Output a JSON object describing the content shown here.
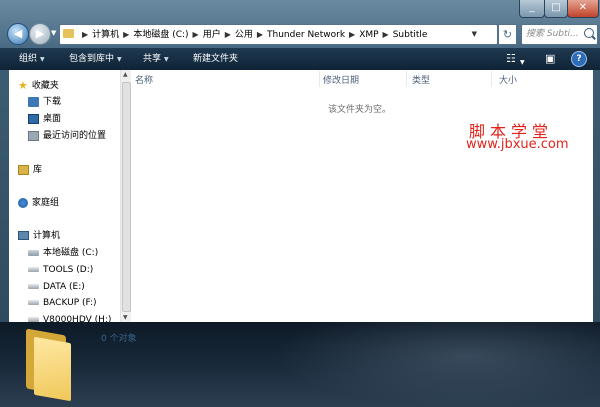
{
  "address": {
    "crumbs": [
      "计算机",
      "本地磁盘 (C:)",
      "用户",
      "公用",
      "Thunder Network",
      "XMP",
      "Subtitle"
    ],
    "search_placeholder": "搜索 Subti..."
  },
  "toolbar": {
    "organize": "组织",
    "include_library": "包含到库中",
    "share": "共享",
    "new_folder": "新建文件夹"
  },
  "nav": {
    "favorites": "收藏夹",
    "downloads": "下载",
    "desktop": "桌面",
    "recent": "最近访问的位置",
    "libraries": "库",
    "homegroup": "家庭组",
    "computer": "计算机",
    "drives": [
      "本地磁盘 (C:)",
      "TOOLS (D:)",
      "DATA (E:)",
      "BACKUP (F:)",
      "V8000HDV (H:)"
    ]
  },
  "columns": [
    "名称",
    "修改日期",
    "类型",
    "大小"
  ],
  "empty_message": "该文件夹为空。",
  "watermark": {
    "line1": "脚本学堂",
    "line2": "www.jbxue.com"
  },
  "details": {
    "count": "0 个对象"
  }
}
